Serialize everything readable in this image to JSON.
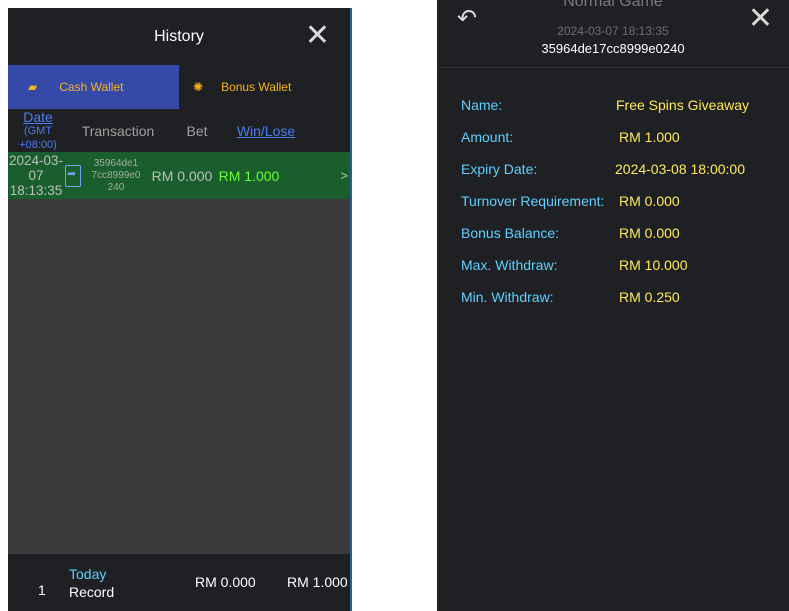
{
  "history": {
    "title": "History",
    "close_icon": "close-icon",
    "tabs": [
      {
        "label": "Cash Wallet",
        "icon": "wallet-icon",
        "active": true
      },
      {
        "label": "Bonus Wallet",
        "icon": "bonus-icon",
        "active": false
      }
    ],
    "columns": {
      "date": "Date",
      "timezone": "(GMT +08:00)",
      "transaction": "Transaction",
      "bet": "Bet",
      "win_lose": "Win/Lose"
    },
    "rows": [
      {
        "date": "2024-03-07",
        "time": "18:13:35",
        "transaction_id_lines": [
          "35964de1",
          "7cc8999e0",
          "240"
        ],
        "bet": "RM 0.000",
        "win_lose": "RM 1.000",
        "arrow": ">"
      }
    ],
    "footer": {
      "count": "1",
      "today": "Today",
      "record": "Record",
      "bet_total": "RM 0.000",
      "win_total": "RM 1.000"
    }
  },
  "detail": {
    "title": "Normal Game",
    "timestamp": "2024-03-07 18:13:35",
    "transaction_id": "35964de17cc8999e0240",
    "back_icon": "back-arrow-icon",
    "close_icon": "close-icon",
    "fields": [
      {
        "label": "Name:",
        "value": "Free Spins Giveaway"
      },
      {
        "label": "Amount:",
        "value": "RM 1.000"
      },
      {
        "label": "Expiry Date:",
        "value": "2024-03-08 18:00:00"
      },
      {
        "label": "Turnover Requirement:",
        "value": "RM 0.000"
      },
      {
        "label": "Bonus Balance:",
        "value": "RM 0.000"
      },
      {
        "label": "Max. Withdraw:",
        "value": "RM 10.000"
      },
      {
        "label": "Min. Withdraw:",
        "value": "RM 0.250"
      }
    ]
  },
  "colors": {
    "panel_bg": "#1f2024",
    "active_tab": "#3549a8",
    "row_highlight": "#1b5e2d",
    "accent_blue": "#4a7bf0",
    "label_cyan": "#5fd0ff",
    "value_yellow": "#ffe95c",
    "win_green": "#66ff33",
    "tab_text": "#f5b320"
  }
}
